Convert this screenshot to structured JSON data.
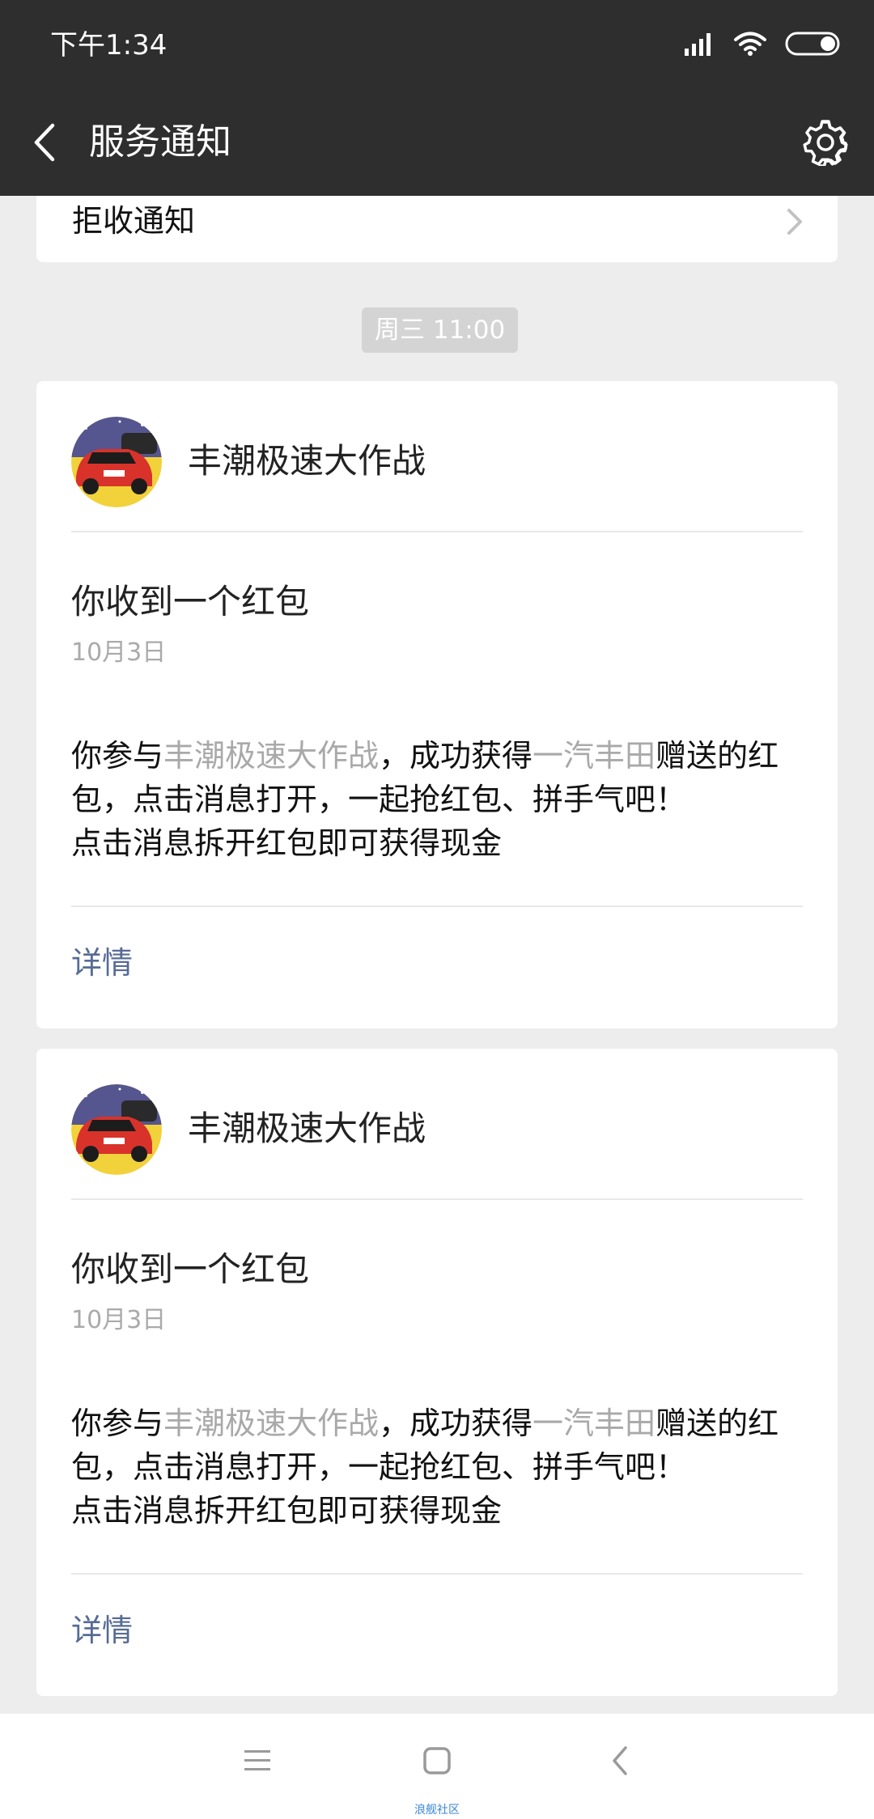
{
  "status_bar": {
    "time": "下午1:34",
    "icons": [
      "signal-icon",
      "wifi-icon",
      "battery-icon"
    ]
  },
  "title_bar": {
    "title": "服务通知",
    "icons": [
      "back-icon",
      "gear-icon"
    ]
  },
  "top_card": {
    "label": "拒收通知"
  },
  "time_separator": "周三 11:00",
  "cards": [
    {
      "sender": "丰潮极速大作战",
      "title": "你收到一个红包",
      "date": "10月3日",
      "body": {
        "part1": "你参与",
        "highlight1": "丰潮极速大作战",
        "part2": "，成功获得",
        "highlight2": "一汽丰田",
        "part3": "赠送的红包，点击消息打开，一起抢红包、拼手气吧！",
        "line2": "点击消息拆开红包即可获得现金"
      },
      "details_label": "详情"
    },
    {
      "sender": "丰潮极速大作战",
      "title": "你收到一个红包",
      "date": "10月3日",
      "body": {
        "part1": "你参与",
        "highlight1": "丰潮极速大作战",
        "part2": "，成功获得",
        "highlight2": "一汽丰田",
        "part3": "赠送的红包，点击消息打开，一起抢红包、拼手气吧！",
        "line2": "点击消息拆开红包即可获得现金"
      },
      "details_label": "详情"
    }
  ],
  "nav_bar": {
    "icons": [
      "menu-icon",
      "home-icon",
      "back-icon"
    ],
    "watermark": "浪舰社区"
  },
  "colors": {
    "header_bg": "#2e2e2e",
    "page_bg": "#ededed",
    "link": "#576b95",
    "highlight_text": "#a9a9a9"
  }
}
